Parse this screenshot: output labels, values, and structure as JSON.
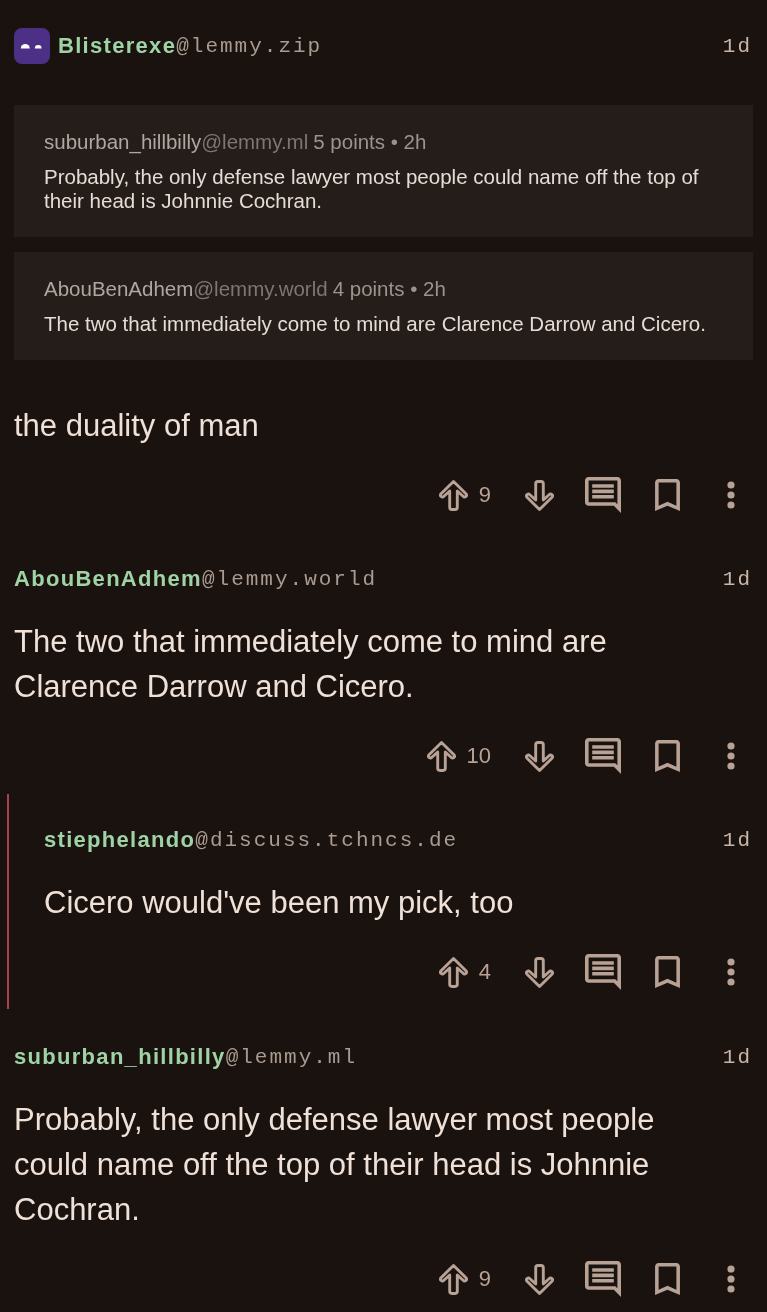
{
  "comments": [
    {
      "author": "Blisterexe",
      "instance": "@lemmy.zip",
      "avatar": true,
      "age": "1d",
      "quotes": [
        {
          "author": "suburban_hillbilly",
          "instance": "@lemmy.ml",
          "meta": "5 points • 2h",
          "body": "Probably, the only defense lawyer most people could name off the top of their head is Johnnie Cochran."
        },
        {
          "author": "AbouBenAdhem",
          "instance": "@lemmy.world",
          "meta": "4 points • 2h",
          "body": "The two that immediately come to mind are Clarence Darrow and Cicero."
        }
      ],
      "body": "the duality of man",
      "score": "9"
    },
    {
      "author": "AbouBenAdhem",
      "instance": "@lemmy.world",
      "avatar": false,
      "age": "1d",
      "body": "The two that immediately come to mind are Clarence Darrow and Cicero.",
      "score": "10",
      "children": [
        {
          "author": "stiephelando",
          "instance": "@discuss.tchncs.de",
          "avatar": false,
          "age": "1d",
          "body": "Cicero would've been my pick, too",
          "score": "4"
        }
      ]
    },
    {
      "author": "suburban_hillbilly",
      "instance": "@lemmy.ml",
      "avatar": false,
      "age": "1d",
      "body": "Probably, the only defense lawyer most people could name off the top of their head is Johnnie Cochran.",
      "score": "9"
    }
  ]
}
